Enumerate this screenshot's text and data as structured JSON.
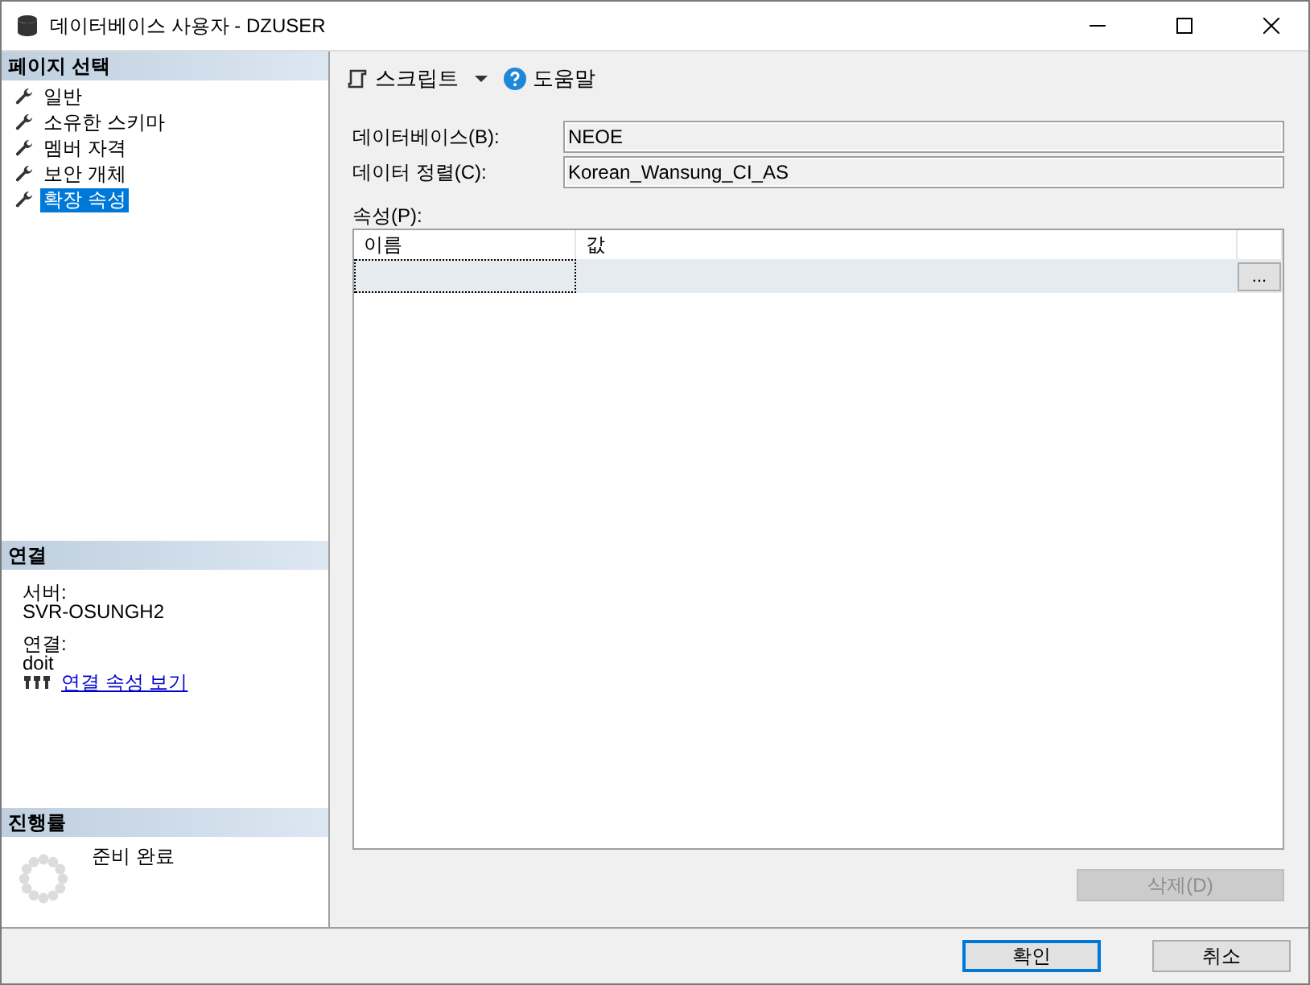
{
  "window": {
    "title": "데이터베이스 사용자 - DZUSER"
  },
  "page_select": {
    "header": "페이지 선택",
    "items": [
      {
        "label": "일반",
        "selected": false
      },
      {
        "label": "소유한 스키마",
        "selected": false
      },
      {
        "label": "멤버 자격",
        "selected": false
      },
      {
        "label": "보안 개체",
        "selected": false
      },
      {
        "label": "확장 속성",
        "selected": true
      }
    ]
  },
  "connection": {
    "header": "연결",
    "server_label": "서버:",
    "server": "SVR-OSUNGH2",
    "connection_label": "연결:",
    "connection": "doit",
    "link": "연결 속성 보기"
  },
  "progress": {
    "header": "진행률",
    "status": "준비 완료"
  },
  "toolbar": {
    "script": "스크립트",
    "help": "도움말"
  },
  "fields": [
    {
      "label": "데이터베이스(B):",
      "value": "NEOE"
    },
    {
      "label": "데이터 정렬(C):",
      "value": "Korean_Wansung_CI_AS"
    }
  ],
  "properties": {
    "label": "속성(P):",
    "columns": [
      "이름",
      "값"
    ],
    "ellipsis_button": "...",
    "delete_button": {
      "label": "삭제(D)",
      "disabled": true
    }
  },
  "buttons": [
    {
      "label": "확인",
      "default": true
    },
    {
      "label": "취소",
      "default": false
    }
  ]
}
